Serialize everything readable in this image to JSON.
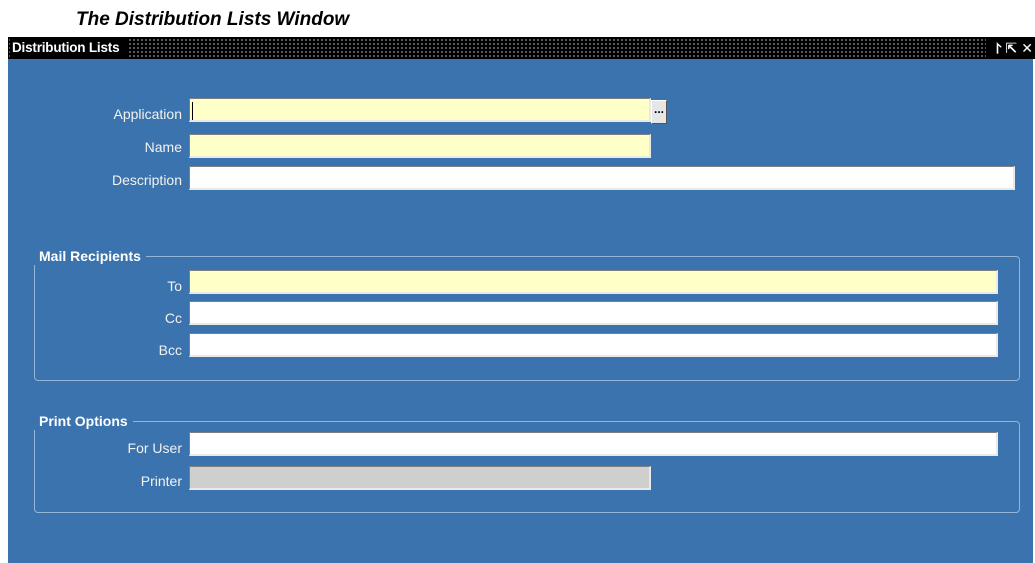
{
  "caption": "The Distribution Lists Window",
  "window": {
    "title": "Distribution Lists",
    "buttons": {
      "minimize_icon": "minimize-icon",
      "maximize_icon": "maximize-icon",
      "close_icon": "close-icon"
    }
  },
  "form": {
    "application": {
      "label": "Application",
      "value": ""
    },
    "name": {
      "label": "Name",
      "value": ""
    },
    "description": {
      "label": "Description",
      "value": ""
    }
  },
  "mail_recipients": {
    "title": "Mail Recipients",
    "to": {
      "label": "To",
      "value": ""
    },
    "cc": {
      "label": "Cc",
      "value": ""
    },
    "bcc": {
      "label": "Bcc",
      "value": ""
    }
  },
  "print_options": {
    "title": "Print Options",
    "for_user": {
      "label": "For User",
      "value": ""
    },
    "printer": {
      "label": "Printer",
      "value": ""
    }
  },
  "lov_button_label": "...",
  "colors": {
    "required_field": "#ffffc8",
    "optional_field": "#ffffff",
    "disabled_field": "#cfcfcf",
    "canvas": "#3a73ad"
  }
}
